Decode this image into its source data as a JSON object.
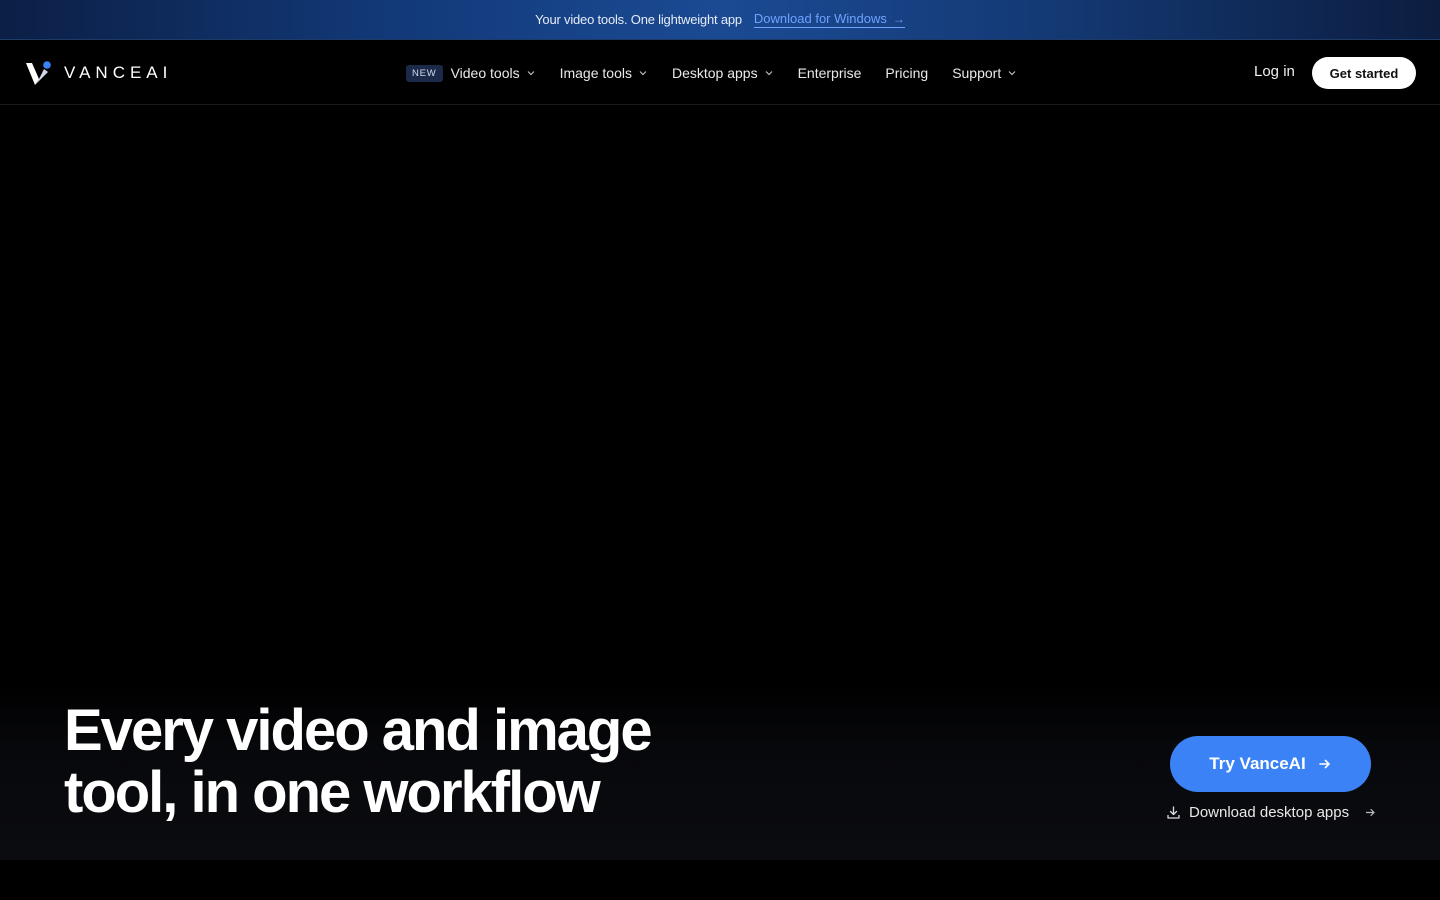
{
  "announcement": {
    "message": "Your video tools. One lightweight app",
    "link_label": "Download for Windows",
    "arrow": "→"
  },
  "nav": {
    "logo_text": "VANCEAI",
    "menu": [
      {
        "label": "Video tools",
        "badge": "NEW",
        "dropdown": true
      },
      {
        "label": "Image tools",
        "dropdown": true
      },
      {
        "label": "Desktop apps",
        "dropdown": true
      },
      {
        "label": "Enterprise",
        "dropdown": false
      },
      {
        "label": "Pricing",
        "dropdown": false
      },
      {
        "label": "Support",
        "dropdown": true
      }
    ],
    "login_label": "Log in",
    "cta_label": "Get started"
  },
  "hero": {
    "headline": "Every video and image tool, in one workflow",
    "primary_cta": "Try VanceAI",
    "secondary_cta": "Download desktop apps"
  },
  "colors": {
    "accent": "#3b82f6",
    "link": "#6ea2ff",
    "background": "#000000"
  }
}
